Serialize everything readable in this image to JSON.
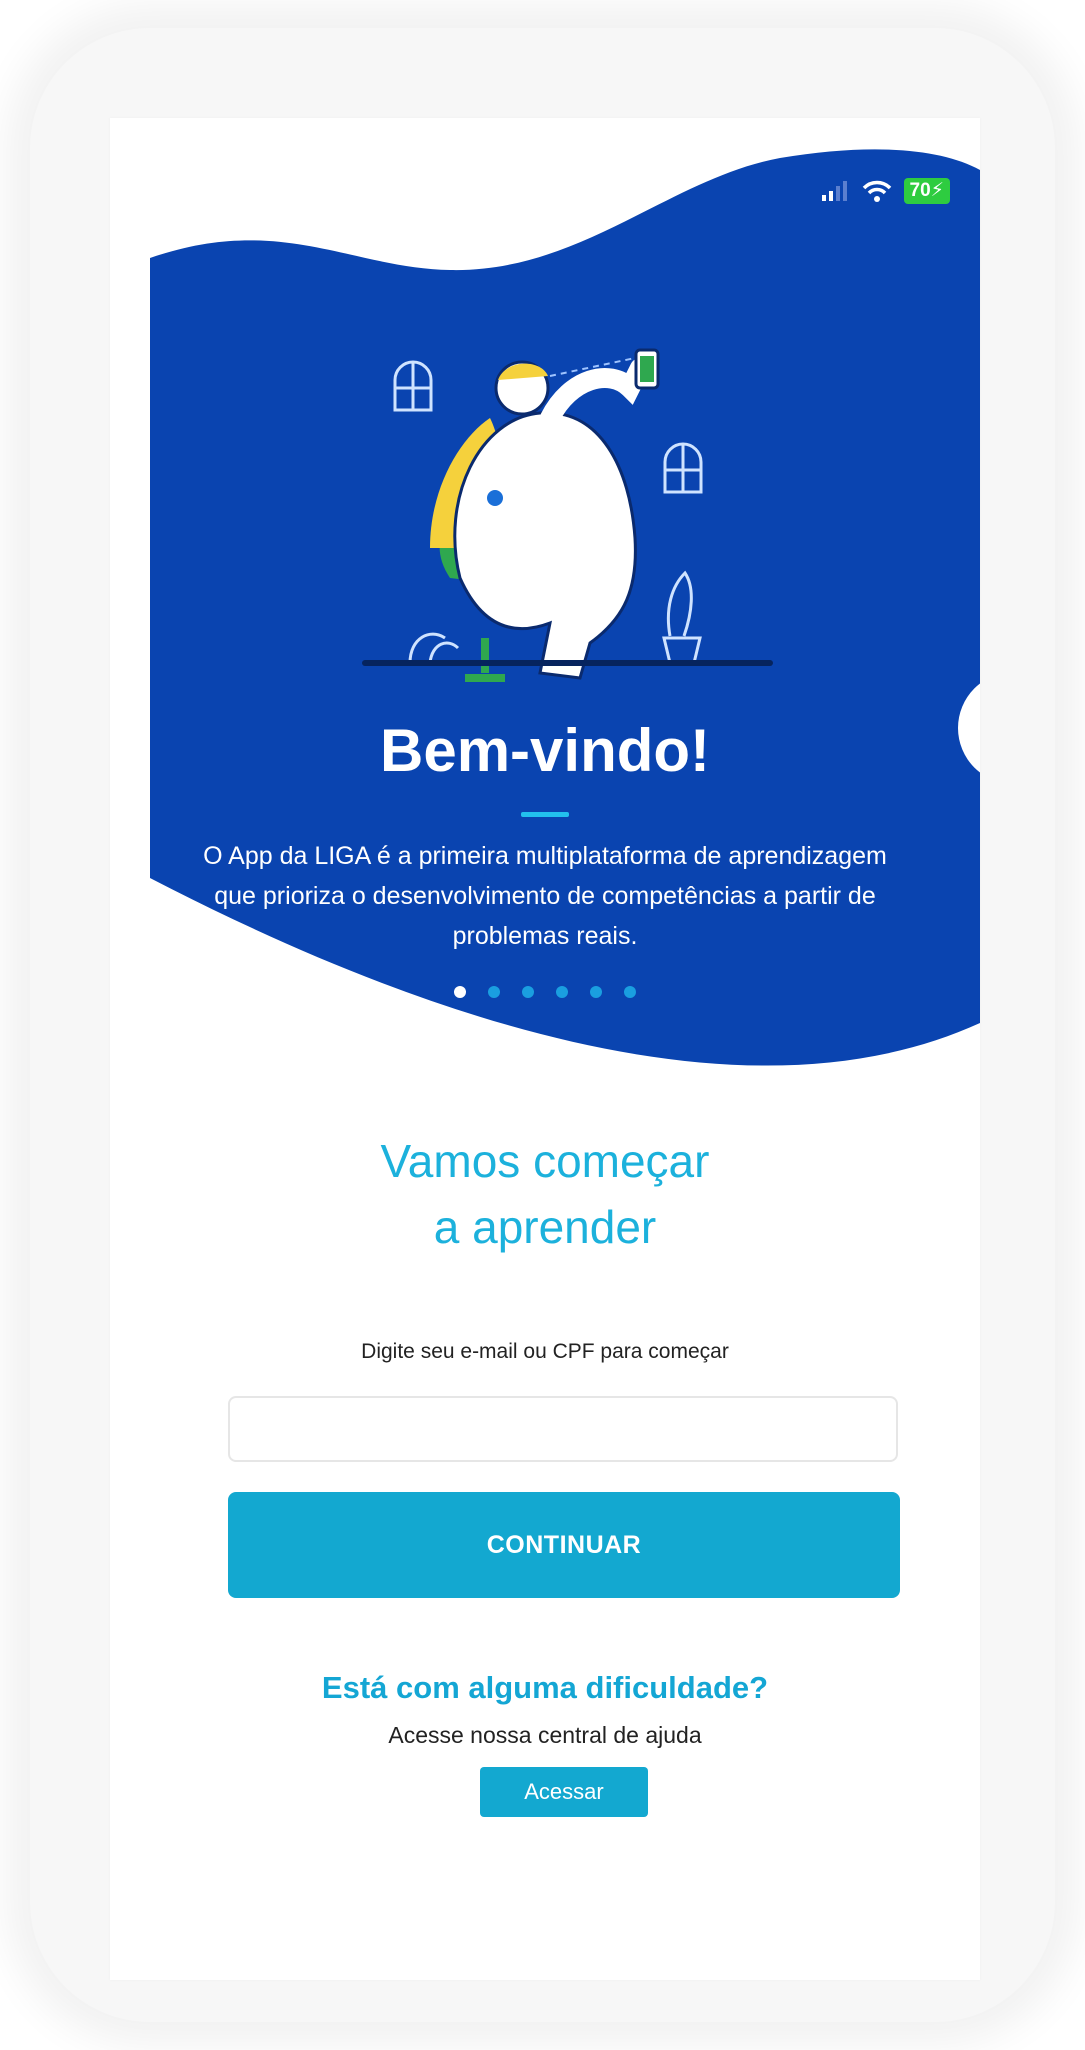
{
  "status_bar": {
    "battery": "70"
  },
  "hero": {
    "title": "Bem-vindo!",
    "text": "O App da LIGA é a primeira multiplataforma de aprendizagem que prioriza o desenvolvimento de competências a partir de problemas reais.",
    "carousel": {
      "total": 6,
      "active_index": 0
    }
  },
  "main": {
    "headline_line1": "Vamos começar",
    "headline_line2": "a aprender",
    "instruction": "Digite seu e-mail ou CPF para começar",
    "input_value": "",
    "continue_label": "CONTINUAR"
  },
  "help": {
    "title": "Está com alguma dificuldade?",
    "text": "Acesse nossa central de ajuda",
    "button_label": "Acessar"
  },
  "colors": {
    "hero_blue": "#0a44b0",
    "accent": "#13a8d0",
    "headline": "#1cb1dc",
    "battery": "#2ecc40"
  }
}
